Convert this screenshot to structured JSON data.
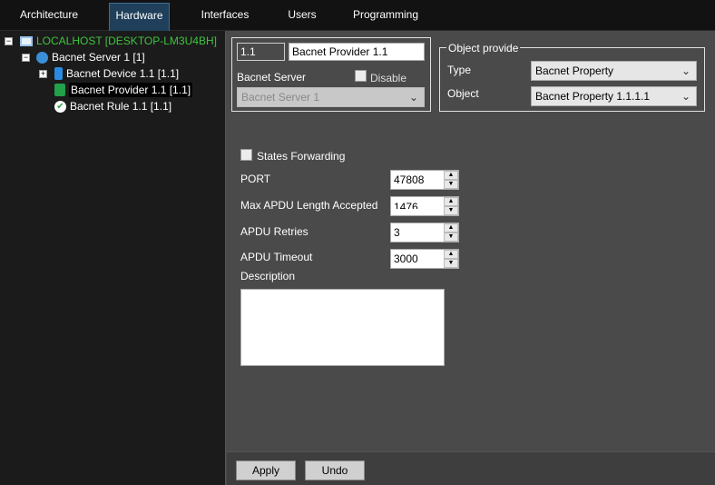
{
  "tabs": [
    "Architecture",
    "Hardware",
    "Interfaces",
    "Users",
    "Programming"
  ],
  "tree": {
    "root": "LOCALHOST [DESKTOP-LM3U4BH]",
    "server": "Bacnet Server 1 [1]",
    "device": "Bacnet Device 1.1 [1.1]",
    "provider": "Bacnet Provider 1.1 [1.1]",
    "rule": "Bacnet Rule 1.1 [1.1]"
  },
  "header": {
    "id": "1.1",
    "name": "Bacnet Provider 1.1",
    "server_label": "Bacnet Server",
    "disable_label": "Disable",
    "server_value": "Bacnet Server 1"
  },
  "object_provide": {
    "title": "Object provide",
    "type_label": "Type",
    "type_value": "Bacnet Property",
    "object_label": "Object",
    "object_value": "Bacnet Property 1.1.1.1"
  },
  "form": {
    "states_forwarding": "States Forwarding",
    "port_label": "PORT",
    "port": "47808",
    "apdu_len_label": "Max APDU Length Accepted",
    "apdu_len": "1476",
    "retries_label": "APDU Retries",
    "retries": "3",
    "timeout_label": "APDU Timeout",
    "timeout": "3000",
    "description_label": "Description",
    "description": ""
  },
  "buttons": {
    "apply": "Apply",
    "undo": "Undo"
  }
}
